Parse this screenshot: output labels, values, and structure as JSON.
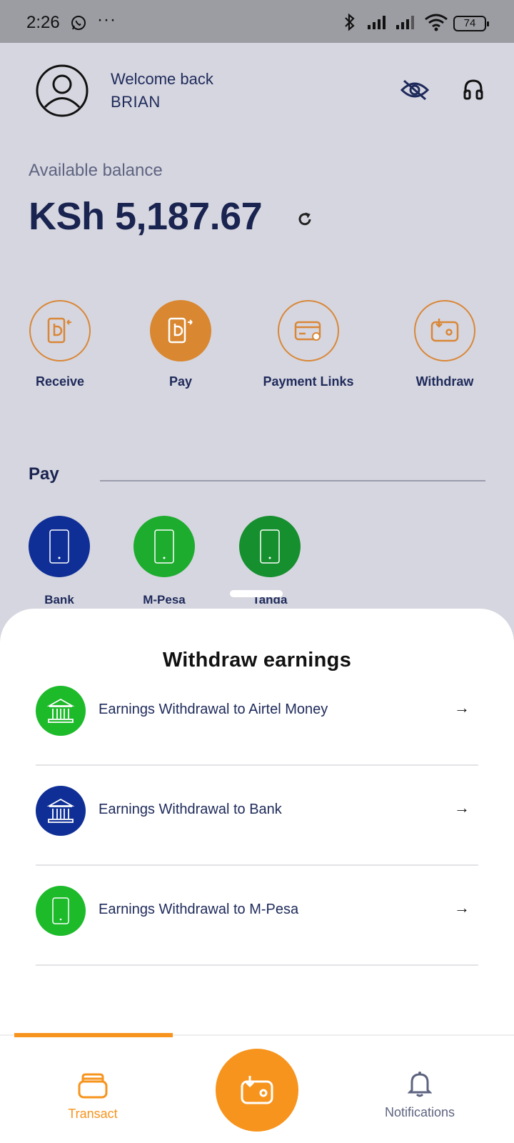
{
  "status_bar": {
    "time": "2:26",
    "more": "···",
    "battery": "74"
  },
  "header": {
    "welcome": "Welcome back",
    "username": "BRIAN"
  },
  "balance": {
    "label": "Available balance",
    "amount": "KSh 5,187.67"
  },
  "actions": [
    {
      "label": "Receive",
      "icon": "receive-icon"
    },
    {
      "label": "Pay",
      "icon": "pay-icon"
    },
    {
      "label": "Payment Links",
      "icon": "payment-links-icon"
    },
    {
      "label": "Withdraw",
      "icon": "withdraw-icon"
    }
  ],
  "pay_section": {
    "title": "Pay",
    "payees": [
      {
        "label": "Bank",
        "color": "#0f2f96"
      },
      {
        "label": "M-Pesa",
        "color": "#1dac2e"
      },
      {
        "label": "Tanda",
        "color": "#168f2e"
      }
    ]
  },
  "sheet": {
    "title": "Withdraw earnings",
    "options": [
      {
        "label": "Earnings Withdrawal to Airtel Money",
        "icon": "bank-icon",
        "color": "#1dba2a"
      },
      {
        "label": "Earnings Withdrawal to Bank",
        "icon": "bank-icon",
        "color": "#0f2f96"
      },
      {
        "label": "Earnings Withdrawal to M-Pesa",
        "icon": "phone-icon",
        "color": "#1dba2a"
      }
    ],
    "arrow": "→"
  },
  "nav": {
    "transact": "Transact",
    "notifications": "Notifications"
  },
  "colors": {
    "accent": "#f7941d",
    "navy": "#1a2450"
  }
}
